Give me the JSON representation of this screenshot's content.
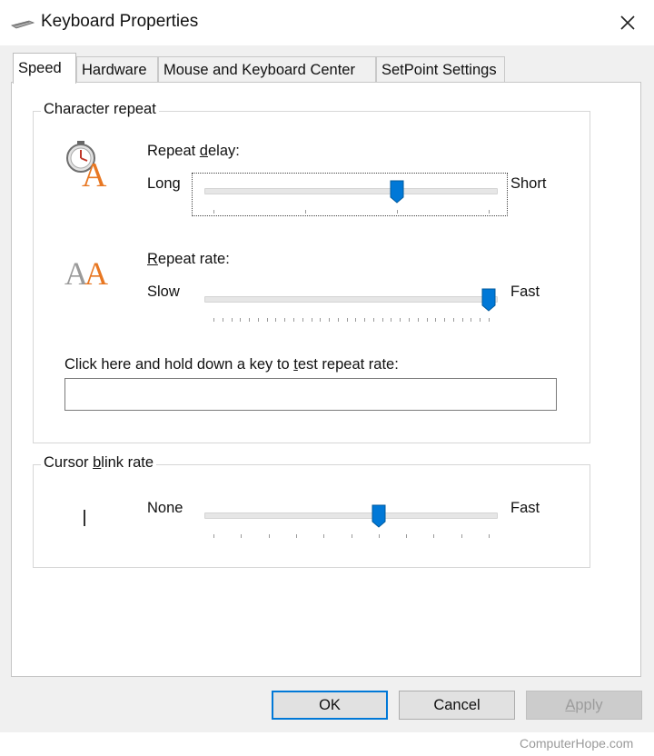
{
  "window": {
    "title": "Keyboard Properties",
    "icons": {
      "app": "keyboard-icon",
      "close": "close-icon"
    }
  },
  "tabs": [
    {
      "label": "Speed",
      "active": true
    },
    {
      "label": "Hardware",
      "active": false
    },
    {
      "label": "Mouse and Keyboard Center",
      "active": false
    },
    {
      "label": "SetPoint Settings",
      "active": false
    }
  ],
  "character_repeat": {
    "legend": "Character repeat",
    "repeat_delay": {
      "label_prefix": "Repeat ",
      "label_mnemonic": "d",
      "label_suffix": "elay:",
      "left_label": "Long",
      "right_label": "Short",
      "value": 2,
      "max": 3,
      "icon": "repeat-delay-icon"
    },
    "repeat_rate": {
      "label_mnemonic": "R",
      "label_suffix": "epeat rate:",
      "left_label": "Slow",
      "right_label": "Fast",
      "value": 31,
      "max": 31,
      "icon": "repeat-rate-icon"
    },
    "test": {
      "label_prefix": "Click here and hold down a key to ",
      "label_mnemonic": "t",
      "label_suffix": "est repeat rate:",
      "value": ""
    }
  },
  "cursor_blink": {
    "legend_prefix": "Cursor ",
    "legend_mnemonic": "b",
    "legend_suffix": "link rate",
    "left_label": "None",
    "right_label": "Fast",
    "value": 6,
    "max": 10,
    "icon": "text-cursor-icon"
  },
  "buttons": {
    "ok": "OK",
    "cancel": "Cancel",
    "apply_mnemonic": "A",
    "apply_suffix": "pply"
  },
  "watermark": "ComputerHope.com",
  "colors": {
    "accent": "#0078d7",
    "icon_orange": "#e87722",
    "icon_gray": "#9a9a9a"
  }
}
